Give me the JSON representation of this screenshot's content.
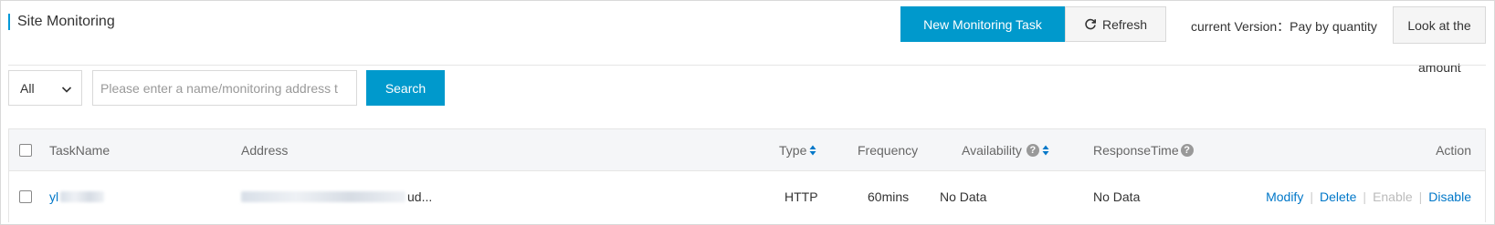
{
  "header": {
    "title": "Site Monitoring",
    "new_task_label": "New Monitoring Task",
    "refresh_label": "Refresh",
    "version_text": "current Version：Pay by quantity",
    "look_label_line1": "Look at the",
    "look_label_line2": "amount"
  },
  "filter": {
    "select_value": "All",
    "search_placeholder": "Please enter a name/monitoring address t",
    "search_value": "",
    "search_button": "Search"
  },
  "table": {
    "columns": {
      "task_name": "TaskName",
      "address": "Address",
      "type": "Type",
      "frequency": "Frequency",
      "availability": "Availability",
      "response_time": "ResponseTime",
      "action": "Action"
    },
    "rows": [
      {
        "task_name_visible": "yl",
        "address_visible": "ud...",
        "type": "HTTP",
        "frequency": "60mins",
        "availability": "No Data",
        "response_time": "No Data",
        "actions": {
          "modify": "Modify",
          "delete": "Delete",
          "enable": "Enable",
          "disable": "Disable"
        }
      }
    ]
  },
  "icons": {
    "refresh": "refresh-icon",
    "chevron": "chevron-down-icon",
    "sort": "sort-icon",
    "help": "help-icon",
    "help_glyph": "?"
  },
  "colors": {
    "primary": "#0099cc",
    "link": "#0077c8",
    "disabled": "#bbbbbb"
  }
}
